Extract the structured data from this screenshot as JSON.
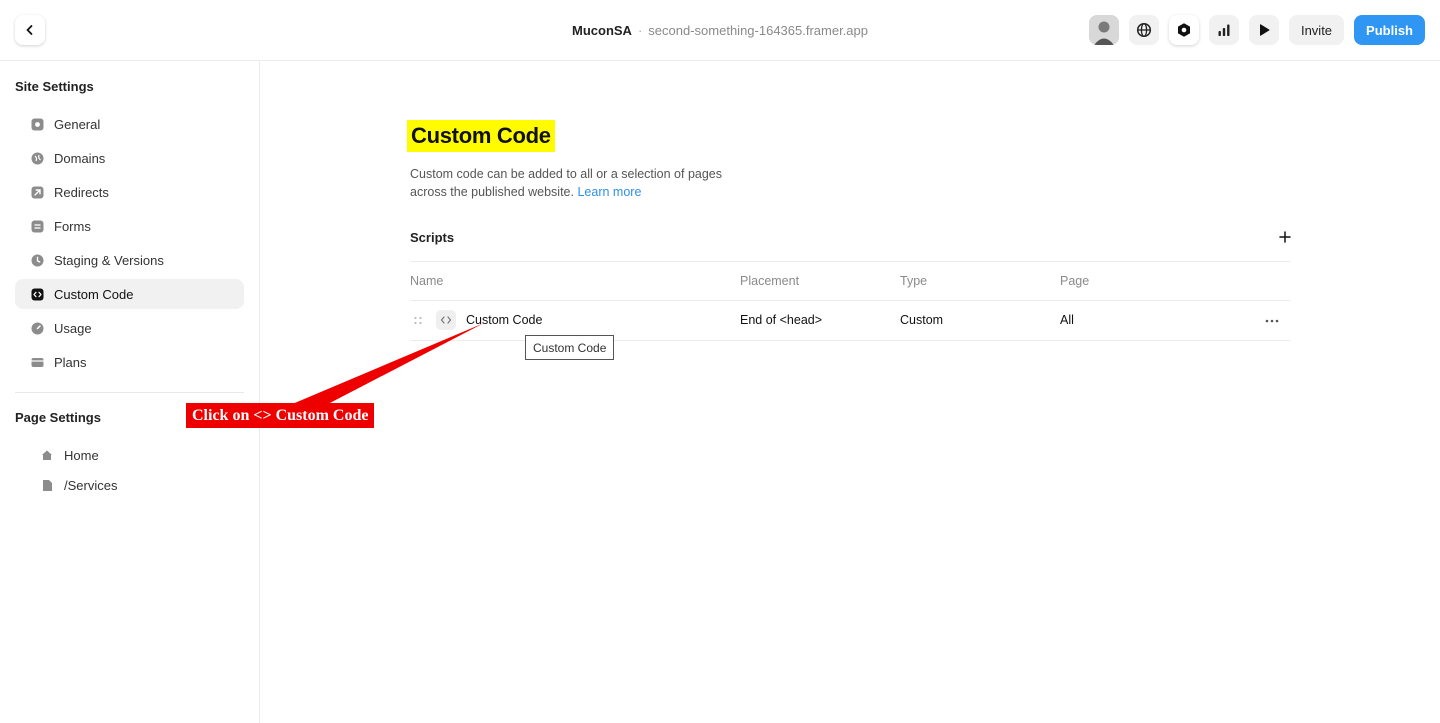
{
  "topbar": {
    "project_name": "MuconSA",
    "separator": "·",
    "site_url": "second-something-164365.framer.app",
    "invite_label": "Invite",
    "publish_label": "Publish"
  },
  "sidebar": {
    "site_settings_heading": "Site Settings",
    "items": [
      {
        "label": "General",
        "icon": "gear-icon"
      },
      {
        "label": "Domains",
        "icon": "globe-icon"
      },
      {
        "label": "Redirects",
        "icon": "redirect-arrow-icon"
      },
      {
        "label": "Forms",
        "icon": "forms-icon"
      },
      {
        "label": "Staging & Versions",
        "icon": "clock-icon"
      },
      {
        "label": "Custom Code",
        "icon": "code-icon",
        "active": true
      },
      {
        "label": "Usage",
        "icon": "gauge-icon"
      },
      {
        "label": "Plans",
        "icon": "card-icon"
      }
    ],
    "page_settings_heading": "Page Settings",
    "pages": [
      {
        "label": "Home",
        "icon": "home-icon"
      },
      {
        "label": "/Services",
        "icon": "page-icon"
      }
    ]
  },
  "main": {
    "title": "Custom Code",
    "description": "Custom code can be added to all or a selection of pages across the published website.",
    "learn_more": "Learn more",
    "scripts_label": "Scripts",
    "table": {
      "headers": [
        "Name",
        "Placement",
        "Type",
        "Page"
      ],
      "rows": [
        {
          "name": "Custom Code",
          "placement": "End of <head>",
          "type": "Custom",
          "page": "All"
        }
      ]
    },
    "tooltip": "Custom Code"
  },
  "annotation": {
    "label": "Click on <> Custom Code",
    "color": "#ee0000"
  },
  "colors": {
    "accent": "#2f96f3",
    "highlight": "#fffb00"
  }
}
